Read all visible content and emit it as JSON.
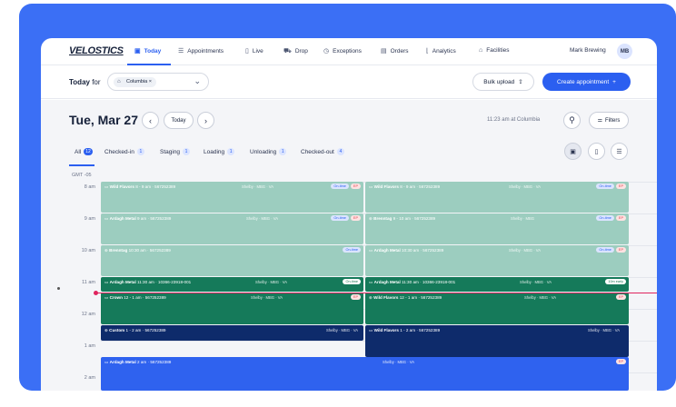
{
  "nav": {
    "logo": "VELOSTICS",
    "items": [
      {
        "label": "Today",
        "icon": "calendar-icon"
      },
      {
        "label": "Appointments",
        "icon": "list-icon"
      },
      {
        "label": "Live",
        "icon": "door-icon"
      },
      {
        "label": "Drop",
        "icon": "truck-icon"
      },
      {
        "label": "Exceptions",
        "icon": "clock-icon"
      },
      {
        "label": "Orders",
        "icon": "order-icon"
      },
      {
        "label": "Analytics",
        "icon": "chart-icon"
      },
      {
        "label": "Facilities",
        "icon": "warehouse-icon"
      }
    ],
    "user": "Mark Brewing",
    "avatar": "MB"
  },
  "todaybar": {
    "label_bold": "Today",
    "label_rest": " for",
    "facility": "Columbia",
    "facility_remove": "×",
    "bulk_upload": "Bulk upload",
    "create": "Create appointment"
  },
  "header": {
    "date": "Tue, Mar 27",
    "today_btn": "Today",
    "time_info": "11:23 am at Columbia",
    "filters": "Filters"
  },
  "tabs": [
    {
      "label": "All",
      "count": "12"
    },
    {
      "label": "Checked-in",
      "count": "1"
    },
    {
      "label": "Staging",
      "count": "1"
    },
    {
      "label": "Loading",
      "count": "1"
    },
    {
      "label": "Unloading",
      "count": "1"
    },
    {
      "label": "Checked-out",
      "count": "4"
    }
  ],
  "calendar": {
    "timezone": "GMT -05",
    "hours": [
      "8 am",
      "9 am",
      "10 am",
      "11 am",
      "12 am",
      "1 am",
      "2 am"
    ],
    "events": [
      {
        "title": "Wild Flavors",
        "time": "8 - 9 am",
        "meta": "Shelby · MBG · VA",
        "ref": "567252389",
        "badges": [
          "On-time",
          "EP"
        ]
      },
      {
        "title": "Wild Flavors",
        "time": "8 - 9 am",
        "meta": "Shelby · MBG · VA",
        "ref": "567252389",
        "badges": [
          "On-time",
          "EP"
        ]
      },
      {
        "title": "Ardagh Metal",
        "time": "9 am",
        "meta": "Shelby · MBG · VA",
        "ref": "567252389",
        "badges": [
          "On-time",
          "EP"
        ]
      },
      {
        "title": "Brenntag",
        "time": "9 - 10 am",
        "meta": "Shelby · MBG",
        "ref": "567252389",
        "badges": [
          "On-time",
          "EP"
        ]
      },
      {
        "title": "Brenntag",
        "time": "10:30 am",
        "meta": "",
        "ref": "567252389",
        "badges": [
          "On-time"
        ]
      },
      {
        "title": "Ardagh Metal",
        "time": "10:30 am",
        "meta": "Shelby · MBG · VA",
        "ref": "567252389",
        "badges": [
          "On-time",
          "EP"
        ]
      },
      {
        "title": "Ardagh Metal",
        "time": "11:30 am",
        "meta": "Shelby · MBG · VA",
        "ref": "10366-23918-001",
        "badges": [
          "On-time"
        ]
      },
      {
        "title": "Ardagh Metal",
        "time": "11:30 am",
        "meta": "Shelby · MBG · VA",
        "ref": "10366-23918-001",
        "badges": [
          "10m early"
        ]
      },
      {
        "title": "Crown",
        "time": "12 - 1 am",
        "meta": "Shelby · MBG · VA",
        "ref": "567252389",
        "badges": [
          "EP"
        ]
      },
      {
        "title": "Wild Flavors",
        "time": "12 - 1 am",
        "meta": "Shelby · MBG · VA",
        "ref": "567252389",
        "badges": [
          "EP"
        ]
      },
      {
        "title": "Custom",
        "time": "1 - 2 am",
        "meta": "Shelby · MBG · VA",
        "ref": "567252389",
        "badges": []
      },
      {
        "title": "Wild Flavors",
        "time": "1 - 2 am",
        "meta": "Shelby · MBG · VA",
        "ref": "567252389",
        "badges": []
      },
      {
        "title": "Ardagh Metal",
        "time": "2 am",
        "meta": "Shelby · MBG · VA",
        "ref": "567252389",
        "badges": [
          "EP"
        ]
      }
    ]
  },
  "colors": {
    "accent": "#2b5ff0",
    "frame": "#3b6ff5",
    "mint": "#9ccdbf",
    "green": "#157a5a",
    "navy": "#0e2b6b",
    "now_line": "#e0245e"
  }
}
